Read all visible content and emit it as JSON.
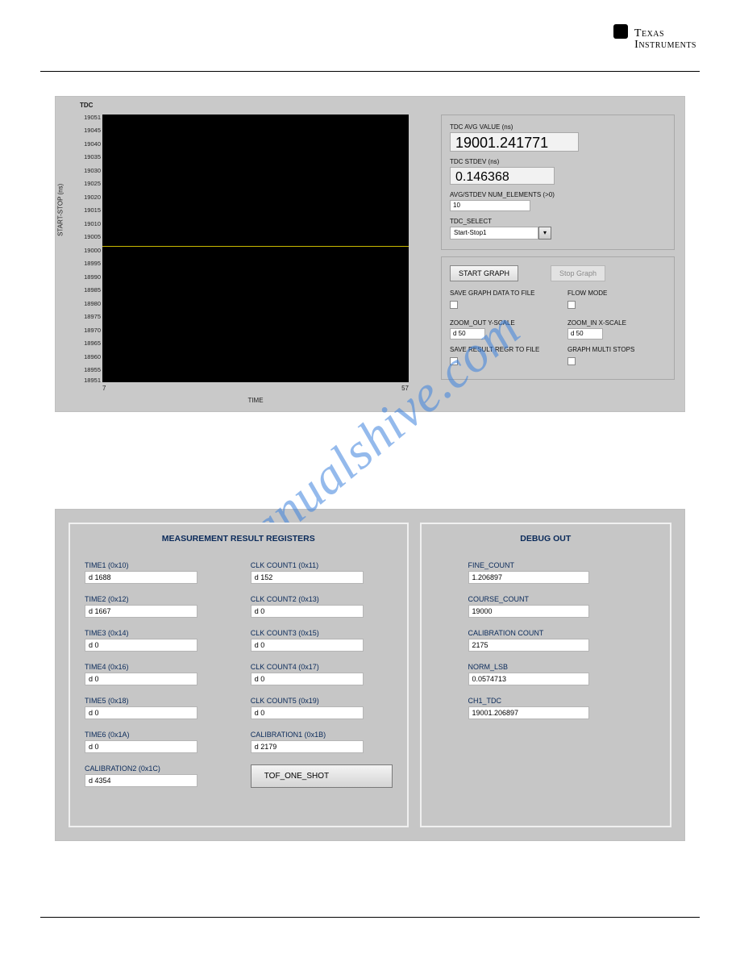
{
  "logo": {
    "line1": "Texas",
    "line2": "Instruments"
  },
  "top": {
    "tdc_label": "TDC",
    "yaxis_label": "START-STOP (ns)",
    "xaxis_label": "TIME",
    "xmin": "7",
    "xmax": "57",
    "yticks": [
      "19051",
      "19045",
      "19040",
      "19035",
      "19030",
      "19025",
      "19020",
      "19015",
      "19010",
      "19005",
      "19000",
      "18995",
      "18990",
      "18985",
      "18980",
      "18975",
      "18970",
      "18965",
      "18960",
      "18955",
      "18951"
    ],
    "avg_label": "TDC AVG VALUE (ns)",
    "avg_value": "19001.241771",
    "stdev_label": "TDC STDEV (ns)",
    "stdev_value": "0.146368",
    "numel_label": "AVG/STDEV NUM_ELEMENTS (>0)",
    "numel_value": "10",
    "select_label": "TDC_SELECT",
    "select_value": "Start-Stop1",
    "start_graph": "START GRAPH",
    "stop_graph": "Stop Graph",
    "save_graph": "SAVE GRAPH DATA TO FILE",
    "flow_mode": "FLOW MODE",
    "zoom_out_label": "ZOOM_OUT Y-SCALE",
    "zoom_out_value": "d 50",
    "zoom_in_label": "ZOOM_IN X-SCALE",
    "zoom_in_value": "d 50",
    "save_regr": "SAVE RESULT REGR TO FILE",
    "multi_stops": "GRAPH MULTI STOPS"
  },
  "chart_data": {
    "type": "line",
    "title": "TDC",
    "xlabel": "TIME",
    "ylabel": "START-STOP (ns)",
    "xlim": [
      7,
      57
    ],
    "ylim": [
      18951,
      19051
    ],
    "series": [
      {
        "name": "Start-Stop1",
        "x": [
          7,
          57
        ],
        "y": [
          19000,
          19000
        ]
      }
    ]
  },
  "watermark": "manualshive.com",
  "bottom": {
    "left_title": "MEASUREMENT RESULT REGISTERS",
    "right_title": "DEBUG OUT",
    "col1": [
      {
        "label": "TIME1 (0x10)",
        "value": "d 1688"
      },
      {
        "label": "TIME2 (0x12)",
        "value": "d 1667"
      },
      {
        "label": "TIME3 (0x14)",
        "value": "d 0"
      },
      {
        "label": "TIME4 (0x16)",
        "value": "d 0"
      },
      {
        "label": "TIME5 (0x18)",
        "value": "d 0"
      },
      {
        "label": "TIME6 (0x1A)",
        "value": "d 0"
      },
      {
        "label": "CALIBRATION2 (0x1C)",
        "value": "d 4354"
      }
    ],
    "col2": [
      {
        "label": "CLK COUNT1 (0x11)",
        "value": "d 152"
      },
      {
        "label": "CLK COUNT2 (0x13)",
        "value": "d 0"
      },
      {
        "label": "CLK COUNT3 (0x15)",
        "value": "d 0"
      },
      {
        "label": "CLK COUNT4 (0x17)",
        "value": "d 0"
      },
      {
        "label": "CLK COUNT5 (0x19)",
        "value": "d 0"
      },
      {
        "label": "CALIBRATION1 (0x1B)",
        "value": "d 2179"
      }
    ],
    "tof_button": "TOF_ONE_SHOT",
    "debug": [
      {
        "label": "FINE_COUNT",
        "value": "1.206897"
      },
      {
        "label": "COURSE_COUNT",
        "value": "19000"
      },
      {
        "label": "CALIBRATION COUNT",
        "value": "2175"
      },
      {
        "label": "NORM_LSB",
        "value": "0.0574713"
      },
      {
        "label": "CH1_TDC",
        "value": "19001.206897"
      }
    ]
  }
}
